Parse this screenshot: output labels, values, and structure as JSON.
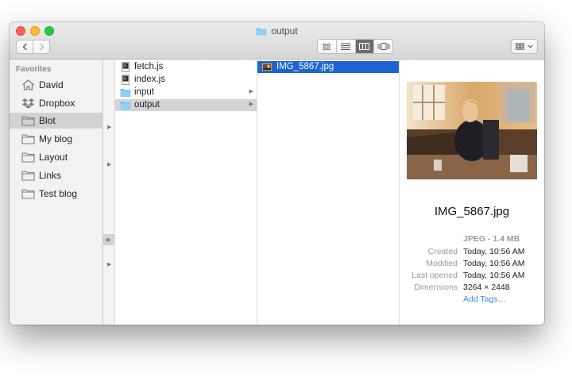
{
  "window": {
    "title": "output"
  },
  "toolbar": {
    "back_icon": "chevron-left-icon",
    "forward_icon": "chevron-right-icon",
    "view_modes": [
      "icon-view",
      "list-view",
      "column-view",
      "cover-flow-view"
    ],
    "active_view": "column-view",
    "arrange_icon": "grid-arrange-icon"
  },
  "sidebar": {
    "heading": "Favorites",
    "items": [
      {
        "label": "David",
        "icon": "home-icon"
      },
      {
        "label": "Dropbox",
        "icon": "dropbox-icon"
      },
      {
        "label": "Blot",
        "icon": "folder-icon",
        "selected": true
      },
      {
        "label": "My blog",
        "icon": "folder-icon"
      },
      {
        "label": "Layout",
        "icon": "folder-icon"
      },
      {
        "label": "Links",
        "icon": "folder-icon"
      },
      {
        "label": "Test blog",
        "icon": "folder-icon"
      }
    ]
  },
  "columns": {
    "col1": [
      {
        "label": "fetch.js",
        "icon": "script-file-icon"
      },
      {
        "label": "index.js",
        "icon": "script-file-icon"
      },
      {
        "label": "input",
        "icon": "folder-icon"
      },
      {
        "label": "output",
        "icon": "folder-icon",
        "selected": true
      }
    ],
    "col2": [
      {
        "label": "IMG_5867.jpg",
        "icon": "image-file-icon",
        "selected": true
      }
    ]
  },
  "preview": {
    "filename": "IMG_5867.jpg",
    "type_size": "JPEG - 1.4 MB",
    "created_label": "Created",
    "created_value": "Today, 10:56 AM",
    "modified_label": "Modified",
    "modified_value": "Today, 10:56 AM",
    "last_opened_label": "Last opened",
    "last_opened_value": "Today, 10:56 AM",
    "dimensions_label": "Dimensions",
    "dimensions_value": "3264 × 2448",
    "add_tags": "Add Tags…"
  },
  "colors": {
    "selection_blue": "#1c64d4",
    "folder_blue": "#6fc0f4",
    "tag_link": "#3b8ae6"
  }
}
